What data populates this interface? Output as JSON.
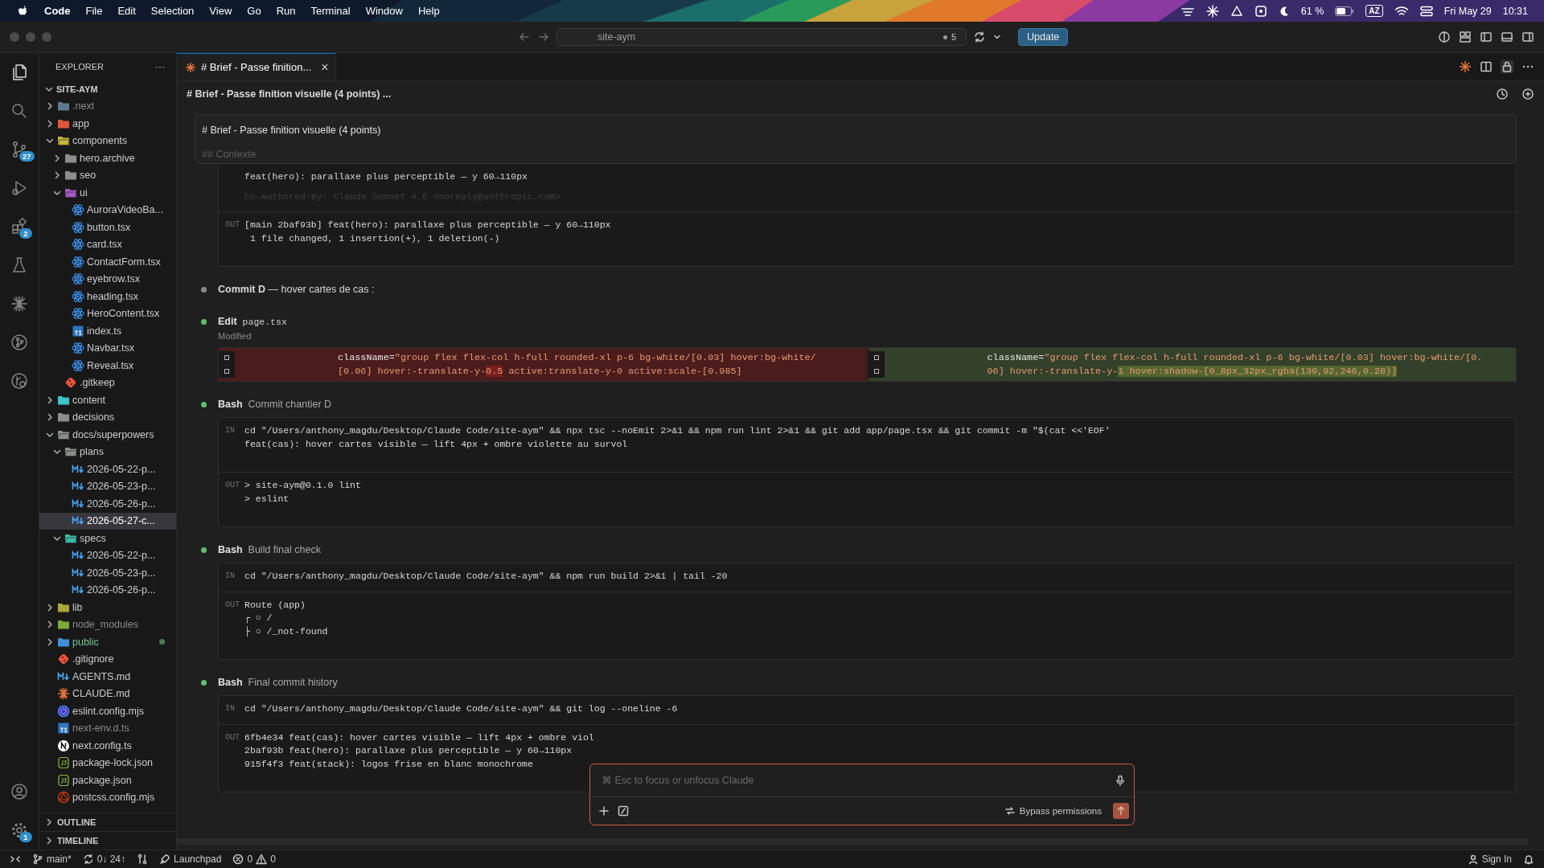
{
  "menu_bar": {
    "app_name": "Code",
    "menus": [
      "File",
      "Edit",
      "Selection",
      "View",
      "Go",
      "Run",
      "Terminal",
      "Window",
      "Help"
    ],
    "battery_percent": "61 %",
    "input_source": "AZ",
    "date": "Fri May 29",
    "time": "10:31"
  },
  "title_bar": {
    "search": {
      "value": "site-aym"
    },
    "changes_count": "5",
    "update_button": "Update"
  },
  "activity_bar": [
    {
      "kind": "explorer",
      "selected": true
    },
    {
      "kind": "search",
      "selected": false
    },
    {
      "kind": "source-control",
      "selected": false,
      "badge": "27"
    },
    {
      "kind": "run",
      "selected": false
    },
    {
      "kind": "extensions",
      "selected": false,
      "badge": "2"
    },
    {
      "kind": "testing",
      "selected": false
    },
    {
      "kind": "claude",
      "selected": false
    },
    {
      "kind": "git-graph",
      "selected": false
    },
    {
      "kind": "git-remote",
      "selected": false
    }
  ],
  "activity_bar_bottom": [
    {
      "kind": "accounts"
    },
    {
      "kind": "settings",
      "badge": "1"
    }
  ],
  "sidebar": {
    "title": "EXPLORER",
    "more": "···",
    "root": {
      "label": "SITE-AYM",
      "expanded": true
    },
    "tree": [
      {
        "label": ".next",
        "kind": "folder",
        "color": "#5d7b8c",
        "expanded": false,
        "dimmed": true
      },
      {
        "label": "app",
        "kind": "folder",
        "color": "#e0533d",
        "expanded": false
      },
      {
        "label": "components",
        "kind": "folder",
        "color": "#c6b63e",
        "expanded": true,
        "children": [
          {
            "label": "hero.archive",
            "kind": "folder",
            "color": "#8a8f8a",
            "expanded": false
          },
          {
            "label": "seo",
            "kind": "folder",
            "color": "#8a8f8a",
            "expanded": false
          },
          {
            "label": "ui",
            "kind": "folder",
            "color": "#a35bc4",
            "expanded": true,
            "children": [
              {
                "label": "AuroraVideoBa...",
                "kind": "react"
              },
              {
                "label": "button.tsx",
                "kind": "react"
              },
              {
                "label": "card.tsx",
                "kind": "react"
              },
              {
                "label": "ContactForm.tsx",
                "kind": "react"
              },
              {
                "label": "eyebrow.tsx",
                "kind": "react"
              },
              {
                "label": "heading.tsx",
                "kind": "react"
              },
              {
                "label": "HeroContent.tsx",
                "kind": "react"
              },
              {
                "label": "index.ts",
                "kind": "ts"
              },
              {
                "label": "Navbar.tsx",
                "kind": "react"
              },
              {
                "label": "Reveal.tsx",
                "kind": "react"
              }
            ]
          },
          {
            "label": ".gitkeep",
            "kind": "git"
          }
        ]
      },
      {
        "label": "content",
        "kind": "folder",
        "color": "#3fc1c9",
        "expanded": false
      },
      {
        "label": "decisions",
        "kind": "folder",
        "color": "#8a8f8a",
        "expanded": false
      },
      {
        "label": "docs/superpowers",
        "kind": "folder",
        "color": "#8a8f8a",
        "expanded": true,
        "children": [
          {
            "label": "plans",
            "kind": "folder",
            "color": "#8a8f8a",
            "expanded": true,
            "children": [
              {
                "label": "2026-05-22-p...",
                "kind": "md"
              },
              {
                "label": "2026-05-23-p...",
                "kind": "md"
              },
              {
                "label": "2026-05-26-p...",
                "kind": "md"
              },
              {
                "label": "2026-05-27-c...",
                "kind": "md",
                "selected": true
              }
            ]
          },
          {
            "label": "specs",
            "kind": "folder",
            "color": "#3fb8a8",
            "expanded": true,
            "children": [
              {
                "label": "2026-05-22-p...",
                "kind": "md"
              },
              {
                "label": "2026-05-23-p...",
                "kind": "md"
              },
              {
                "label": "2026-05-26-p...",
                "kind": "md"
              }
            ]
          }
        ]
      },
      {
        "label": "lib",
        "kind": "folder",
        "color": "#a8a83a",
        "expanded": false
      },
      {
        "label": "node_modules",
        "kind": "folder",
        "color": "#7fa83a",
        "expanded": false,
        "dimmed": true
      },
      {
        "label": "public",
        "kind": "folder",
        "color": "#3d8fd6",
        "expanded": false,
        "modified": true
      },
      {
        "label": ".gitignore",
        "kind": "git"
      },
      {
        "label": "AGENTS.md",
        "kind": "md"
      },
      {
        "label": "CLAUDE.md",
        "kind": "claude"
      },
      {
        "label": "eslint.config.mjs",
        "kind": "eslint"
      },
      {
        "label": "next-env.d.ts",
        "kind": "ts",
        "dimmed": true
      },
      {
        "label": "next.config.ts",
        "kind": "next"
      },
      {
        "label": "package-lock.json",
        "kind": "js"
      },
      {
        "label": "package.json",
        "kind": "js"
      },
      {
        "label": "postcss.config.mjs",
        "kind": "postcss"
      }
    ],
    "sections": [
      {
        "label": "OUTLINE",
        "expanded": false
      },
      {
        "label": "TIMELINE",
        "expanded": false
      }
    ]
  },
  "editor": {
    "tab": {
      "label": "# Brief - Passe finition...",
      "close": "×",
      "selected": true
    },
    "header_title": "# Brief - Passe finition visuelle (4 points) ...",
    "prompt": {
      "title": "# Brief - Passe finition visuelle (4 points)",
      "next_line": "## Contexte"
    },
    "transcript": [
      {
        "kind": "tail",
        "in_lines": [
          "feat(hero): parallaxe plus perceptible — y 60→110px"
        ],
        "in_faded": "Co-Authored-By: Claude Sonnet 4.6 <noreply@anthropic.com>",
        "out_label": "OUT",
        "out_lines": [
          "[main 2baf93b] feat(hero): parallaxe plus perceptible — y 60→110px",
          " 1 file changed, 1 insertion(+), 1 deletion(-)"
        ]
      },
      {
        "kind": "message",
        "color": "#8a8a8a",
        "text": "**Commit D** — hover cartes de cas :"
      },
      {
        "kind": "edit",
        "color": "#5fbf6f",
        "tool": "Edit",
        "file": "page.tsx",
        "status": "Modified",
        "removed": [
          [
            {
              "kind": "attr",
              "text": "className="
            },
            {
              "kind": "str",
              "text": "\"group flex flex-col h-full rounded-xl p-6 bg-white/[0.03] hover:bg-white/"
            }
          ],
          [
            {
              "kind": "str",
              "text": "[0.06] hover:-translate-y-"
            },
            {
              "kind": "str",
              "text": "0.5",
              "changed": true
            },
            {
              "kind": "str",
              "text": " active:translate-y-0 active:scale-[0.985]"
            }
          ]
        ],
        "added": [
          [
            {
              "kind": "attr",
              "text": "className="
            },
            {
              "kind": "str",
              "text": "\"group flex flex-col h-full rounded-xl p-6 bg-white/[0.03] hover:bg-white/[0."
            }
          ],
          [
            {
              "kind": "str",
              "text": "06] hover:-translate-y-"
            },
            {
              "kind": "str",
              "text": "1 hover:shadow-[0_8px_32px_rgba(139,92,246,0.28)]",
              "changed": true
            }
          ]
        ]
      },
      {
        "kind": "tool",
        "color": "#5fbf6f",
        "tool": "Bash",
        "desc": "Commit chantier D",
        "in_label": "IN",
        "in_lines": [
          "cd \"/Users/anthony_magdu/Desktop/Claude Code/site-aym\" && npx tsc --noEmit 2>&1 && npm run lint 2>&1 && git add app/page.tsx && git commit -m \"$(cat <<'EOF'",
          "feat(cas): hover cartes visible — lift 4px + ombre violette au survol"
        ],
        "out_label": "OUT",
        "out_lines": [
          "> site-aym@0.1.0 lint",
          "> eslint"
        ]
      },
      {
        "kind": "tool",
        "color": "#5fbf6f",
        "tool": "Bash",
        "desc": "Build final check",
        "in_label": "IN",
        "in_lines": [
          "cd \"/Users/anthony_magdu/Desktop/Claude Code/site-aym\" && npm run build 2>&1 | tail -20"
        ],
        "out_label": "OUT",
        "out_lines": [
          "Route (app)",
          "┌ ○ /",
          "├ ○ /_not-found"
        ]
      },
      {
        "kind": "tool",
        "color": "#5fbf6f",
        "tool": "Bash",
        "desc": "Final commit history",
        "in_label": "IN",
        "in_lines": [
          "cd \"/Users/anthony_magdu/Desktop/Claude Code/site-aym\" && git log --oneline -6"
        ],
        "out_label": "OUT",
        "out_lines": [
          "6fb4e34 feat(cas): hover cartes visible — lift 4px + ombre viol",
          "2baf93b feat(hero): parallaxe plus perceptible — y 60→110px",
          "915f4f3 feat(stack): logos frise en blanc monochrome"
        ]
      }
    ],
    "chat_input": {
      "placeholder": "⌘ Esc to focus or unfocus Claude",
      "mode": "Bypass permissions"
    }
  },
  "status_bar": {
    "branch": "main*",
    "sync": "0↓ 24↑",
    "launchpad": "Launchpad",
    "errors": "0",
    "warnings": "0",
    "sign_in": "Sign In"
  }
}
